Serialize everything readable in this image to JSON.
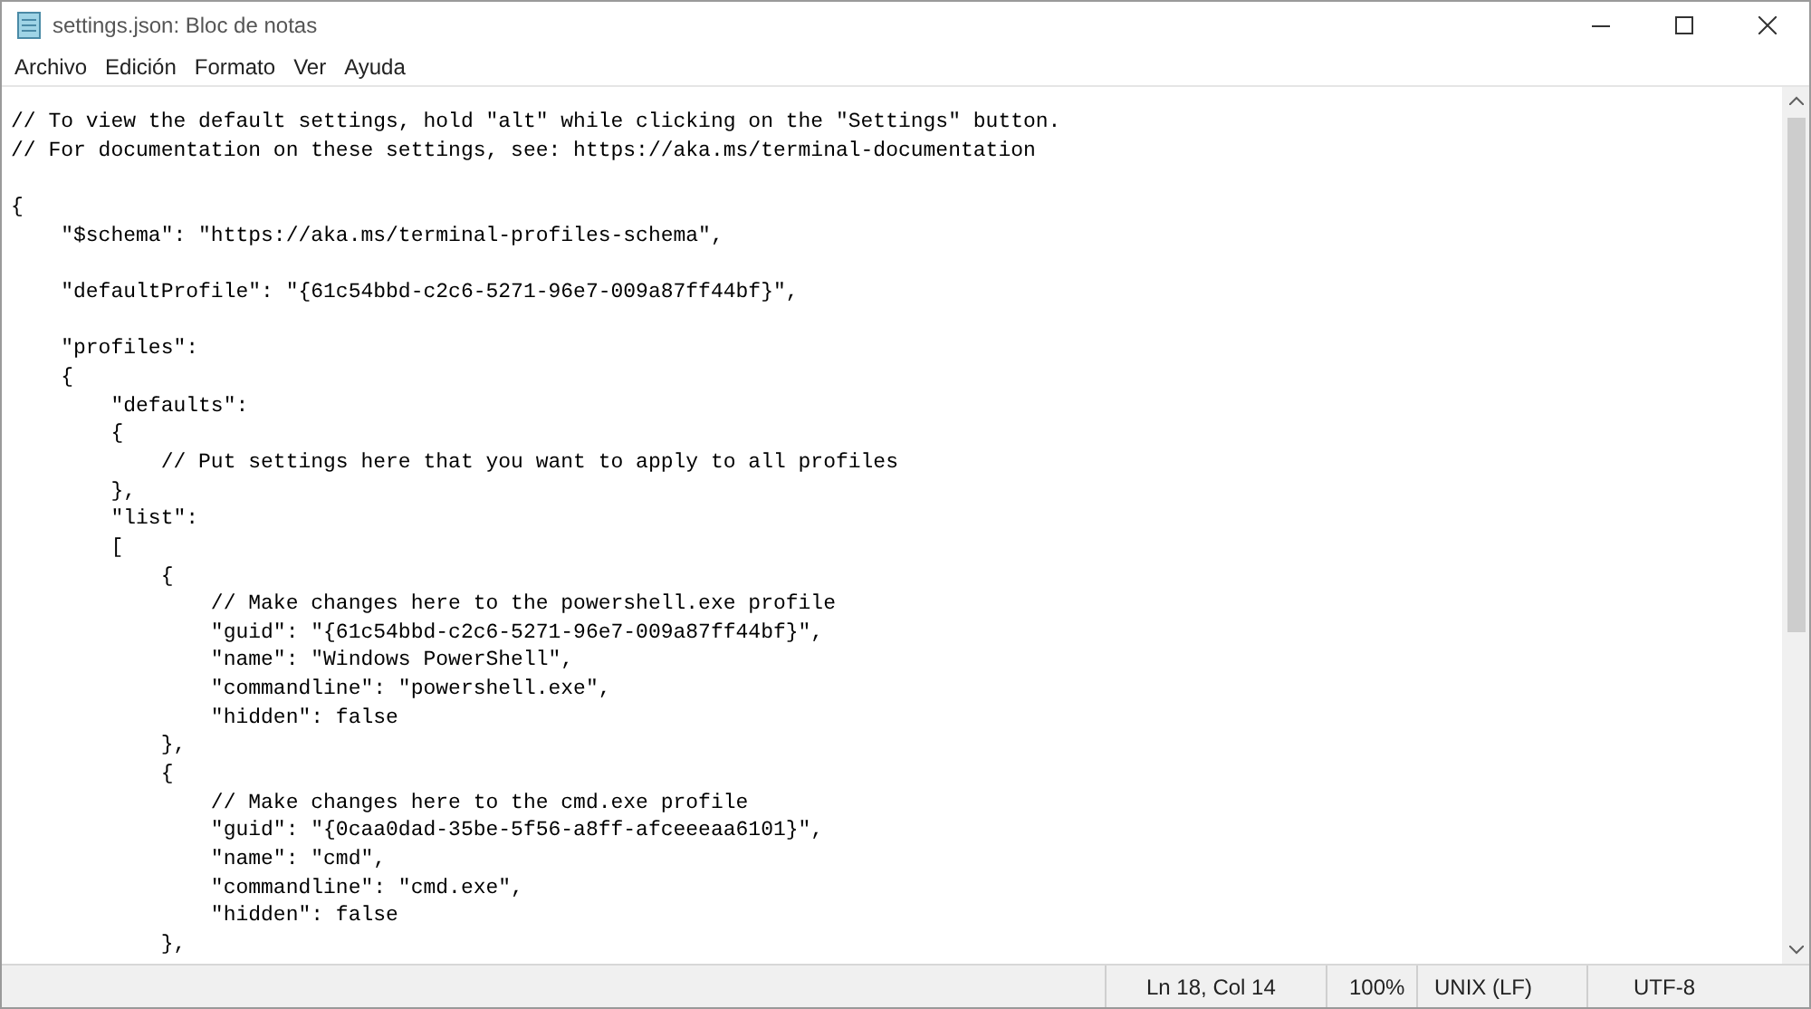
{
  "window": {
    "title": "settings.json: Bloc de notas"
  },
  "menu": [
    "Archivo",
    "Edición",
    "Formato",
    "Ver",
    "Ayuda"
  ],
  "editor": {
    "lines": [
      {
        "kind": "code",
        "text": "// To view the default settings, hold \"alt\" while clicking on the \"Settings\" button."
      },
      {
        "kind": "code",
        "text": "// For documentation on these settings, see: https://aka.ms/terminal-documentation"
      },
      {
        "kind": "blank"
      },
      {
        "kind": "code",
        "text": "{"
      },
      {
        "kind": "code",
        "text": "    \"$schema\": \"https://aka.ms/terminal-profiles-schema\","
      },
      {
        "kind": "blank"
      },
      {
        "kind": "code",
        "text": "    \"defaultProfile\": \"{61c54bbd-c2c6-5271-96e7-009a87ff44bf}\","
      },
      {
        "kind": "blank"
      },
      {
        "kind": "code",
        "text": "    \"profiles\":"
      },
      {
        "kind": "code",
        "text": "    {"
      },
      {
        "kind": "code",
        "text": "        \"defaults\":"
      },
      {
        "kind": "code",
        "text": "        {"
      },
      {
        "kind": "code",
        "text": "            // Put settings here that you want to apply to all profiles"
      },
      {
        "kind": "code",
        "text": "        },"
      },
      {
        "kind": "code",
        "text": "        \"list\":"
      },
      {
        "kind": "code",
        "text": "        ["
      },
      {
        "kind": "code",
        "text": "            {"
      },
      {
        "kind": "code",
        "text": "                // Make changes here to the powershell.exe profile"
      },
      {
        "kind": "code",
        "text": "                \"guid\": \"{61c54bbd-c2c6-5271-96e7-009a87ff44bf}\","
      },
      {
        "kind": "code",
        "text": "                \"name\": \"Windows PowerShell\","
      },
      {
        "kind": "code",
        "text": "                \"commandline\": \"powershell.exe\","
      },
      {
        "kind": "code",
        "text": "                \"hidden\": false"
      },
      {
        "kind": "code",
        "text": "            },"
      },
      {
        "kind": "code",
        "text": "            {"
      },
      {
        "kind": "code",
        "text": "                // Make changes here to the cmd.exe profile"
      },
      {
        "kind": "code",
        "text": "                \"guid\": \"{0caa0dad-35be-5f56-a8ff-afceeeaa6101}\","
      },
      {
        "kind": "code",
        "text": "                \"name\": \"cmd\","
      },
      {
        "kind": "code",
        "text": "                \"commandline\": \"cmd.exe\","
      },
      {
        "kind": "code",
        "text": "                \"hidden\": false"
      },
      {
        "kind": "code",
        "text": "            },"
      }
    ]
  },
  "status_bar": {
    "position": "Ln 18, Col 14",
    "zoom": "100%",
    "line_endings": "UNIX (LF)",
    "encoding": "UTF-8"
  }
}
